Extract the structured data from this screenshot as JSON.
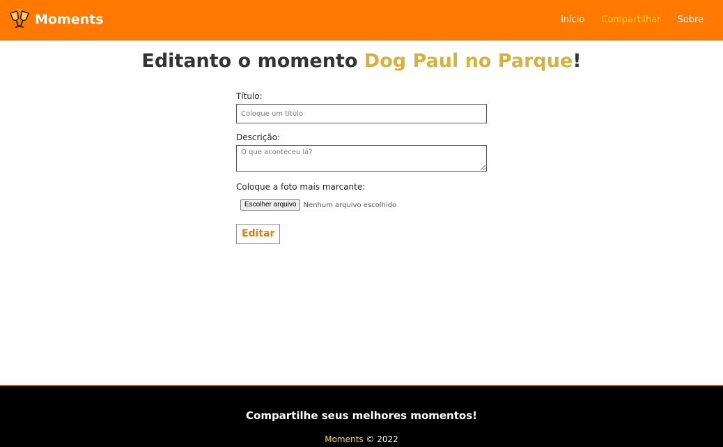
{
  "colors": {
    "navbar_bg": "#ff7800",
    "accent": "#ffd93a",
    "title_highlight": "#d4b23c",
    "button_border": "#e07b20",
    "footer_bg": "#000000"
  },
  "navbar": {
    "logo_icon": "champagne-toast-icon",
    "brand": "Moments",
    "links": [
      {
        "label": "Início",
        "active": false
      },
      {
        "label": "Compartilhar",
        "active": true
      },
      {
        "label": "Sobre",
        "active": false
      }
    ]
  },
  "page": {
    "title_prefix": "Editanto o momento ",
    "title_moment": "Dog Paul no Parque",
    "title_suffix": "!"
  },
  "form": {
    "title_label": "Título:",
    "title_placeholder": "Coloque um título",
    "title_value": "",
    "description_label": "Descrição:",
    "description_placeholder": "O que aconteceu lá?",
    "description_value": "",
    "photo_label": "Coloque a foto mais marcante:",
    "file_button": "Escolher arquivo",
    "file_status": "Nenhum arquivo escolhido",
    "submit_label": "Editar"
  },
  "footer": {
    "tagline": "Compartilhe seus melhores momentos!",
    "brand": "Moments",
    "copyright": " © 2022"
  }
}
